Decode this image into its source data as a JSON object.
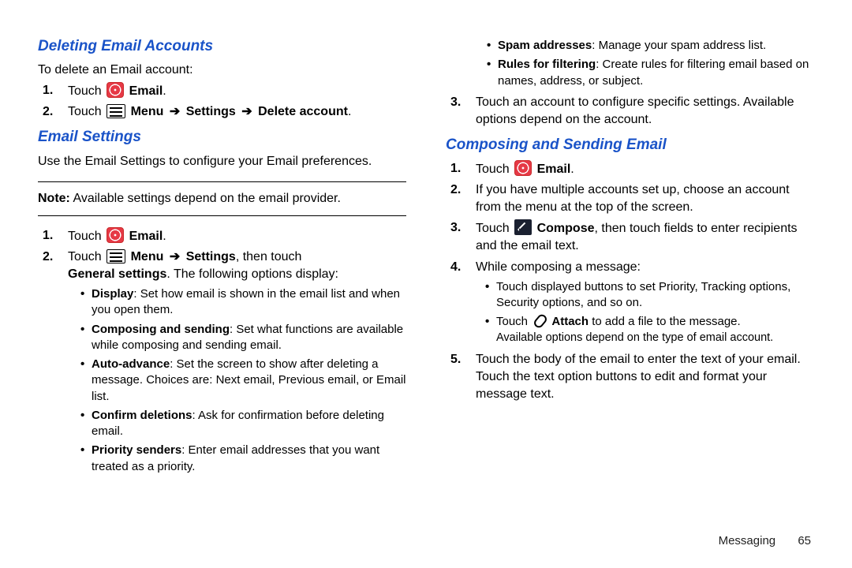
{
  "left": {
    "h1": "Deleting Email Accounts",
    "intro1": "To delete an Email account:",
    "s1_touch": "Touch ",
    "s1_email": "Email",
    "s2_touch": "Touch ",
    "s2_menu": "Menu",
    "s2_settings": "Settings",
    "s2_delete": "Delete account",
    "h2": "Email Settings",
    "intro2": "Use the Email Settings to configure your Email preferences.",
    "note_b": "Note:",
    "note_t": " Available settings depend on the email provider.",
    "s3_touch": "Touch ",
    "s3_email": "Email",
    "s4_touch": "Touch ",
    "s4_menu": "Menu",
    "s4_settings": "Settings",
    "s4_then": ", then touch",
    "s4_general_b": "General settings",
    "s4_general_t": ". The following options display:",
    "b1_b": "Display",
    "b1_t": ": Set how email is shown in the email list and when you open them.",
    "b2_b": "Composing and sending",
    "b2_t": ": Set what functions are available while composing and sending email.",
    "b3_b": "Auto-advance",
    "b3_t": ": Set the screen to show after deleting a message. Choices are: Next email, Previous email, or Email list.",
    "b4_b": "Confirm deletions",
    "b4_t": ": Ask for confirmation before deleting email.",
    "b5_b": "Priority senders",
    "b5_t": ": Enter email addresses that you want treated as a priority."
  },
  "right": {
    "b6_b": "Spam addresses",
    "b6_t": ": Manage your spam address list.",
    "b7_b": "Rules for filtering",
    "b7_t": ": Create rules for filtering email based on names, address, or subject.",
    "s5": "Touch an account to configure specific settings. Available options depend on the account.",
    "h3": "Composing and Sending Email",
    "c1_touch": "Touch ",
    "c1_email": "Email",
    "c2": "If you have multiple accounts set up, choose an account from the menu at the top of the screen.",
    "c3_touch": "Touch ",
    "c3_compose": "Compose",
    "c3_tail": ", then touch fields to enter recipients and the email text.",
    "c4": "While composing a message:",
    "c4b1": "Touch displayed buttons to set Priority, Tracking options, Security options, and so on.",
    "c4b2_touch": "Touch ",
    "c4b2_attach": "Attach",
    "c4b2_tail": " to add a file to the message.",
    "c4b2_sub": "Available options depend on the type of email account.",
    "c5": "Touch the body of the email to enter the text of your email. Touch the text option buttons to edit and format your message text."
  },
  "arrow": "➔",
  "footer": {
    "section": "Messaging",
    "page": "65"
  },
  "dot": "."
}
